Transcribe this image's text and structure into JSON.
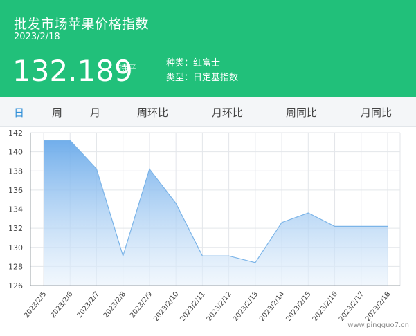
{
  "header": {
    "title": "批发市场苹果价格指数",
    "date": "2023/2/18",
    "price": "132.189",
    "trend": "持平",
    "kind": "种类：红富士",
    "type": "类型：日定基指数",
    "background_color": "#21c07a"
  },
  "tabs": [
    {
      "label": "日",
      "active": true
    },
    {
      "label": "周",
      "active": false
    },
    {
      "label": "月",
      "active": false
    },
    {
      "label": "周环比",
      "active": false
    },
    {
      "label": "月环比",
      "active": false
    },
    {
      "label": "周同比",
      "active": false
    },
    {
      "label": "月同比",
      "active": false
    }
  ],
  "chart_data": {
    "type": "area",
    "title": "",
    "xlabel": "",
    "ylabel": "",
    "x": [
      "2023/2/5",
      "2023/2/6",
      "2023/2/7",
      "2023/2/8",
      "2023/2/9",
      "2023/2/10",
      "2023/2/11",
      "2023/2/12",
      "2023/2/13",
      "2023/2/14",
      "2023/2/15",
      "2023/2/16",
      "2023/2/17",
      "2023/2/18"
    ],
    "series": [
      {
        "values": [
          141.2,
          141.2,
          138.2,
          129.1,
          138.2,
          134.6,
          129.1,
          129.1,
          128.4,
          132.6,
          133.6,
          132.2,
          132.2,
          132.2
        ],
        "color": "#7bb4e8"
      }
    ],
    "ylim": [
      126,
      142
    ],
    "yticks": [
      126,
      128,
      130,
      132,
      134,
      136,
      138,
      140,
      142
    ],
    "grid": true
  },
  "watermark": "www.pingguo7.cn"
}
